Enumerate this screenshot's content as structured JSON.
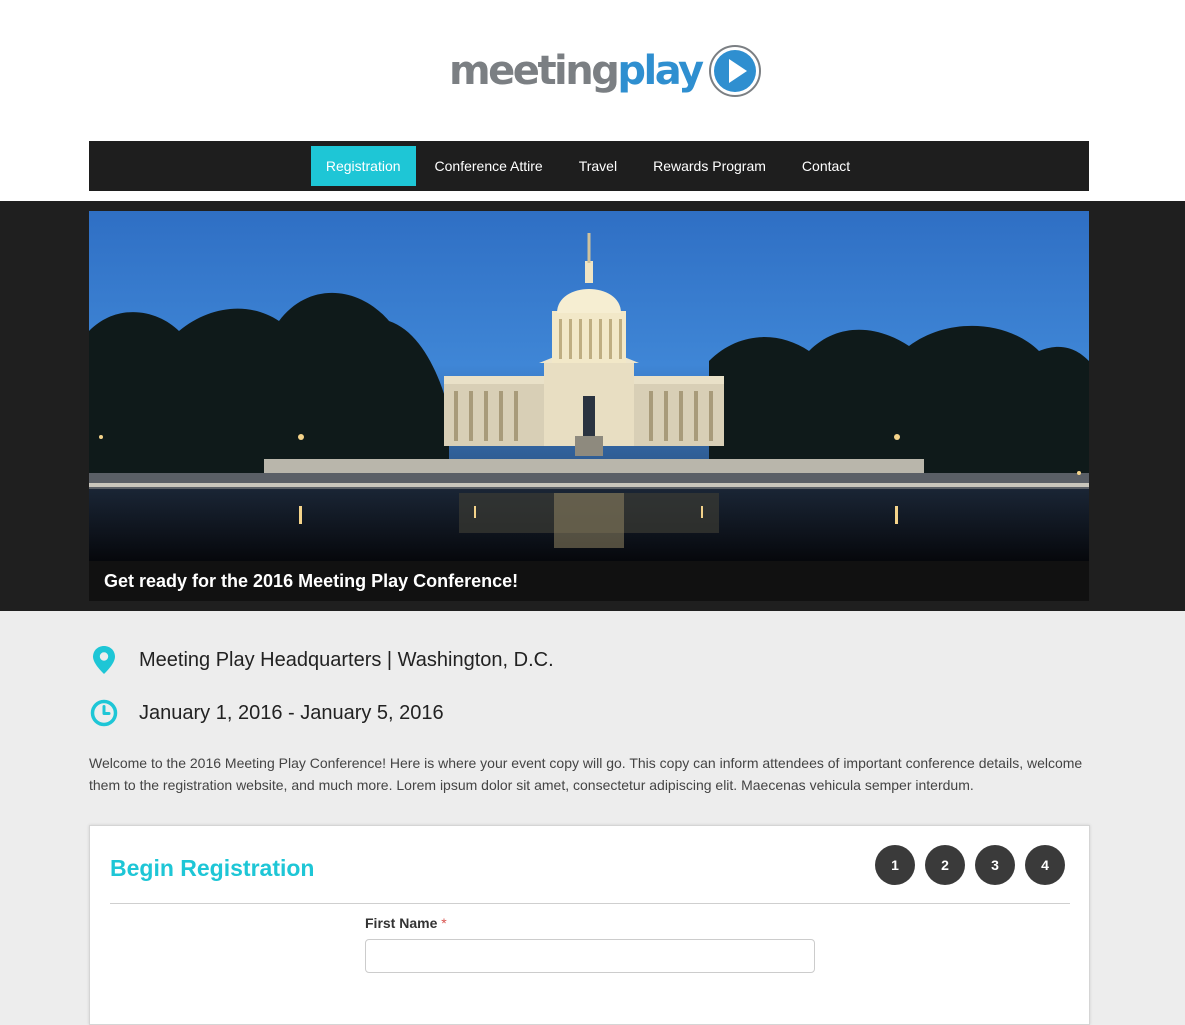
{
  "brand": {
    "logo_part1": "meeting",
    "logo_part2": "play"
  },
  "nav": {
    "items": [
      {
        "label": "Registration",
        "active": true
      },
      {
        "label": "Conference Attire",
        "active": false
      },
      {
        "label": "Travel",
        "active": false
      },
      {
        "label": "Rewards Program",
        "active": false
      },
      {
        "label": "Contact",
        "active": false
      }
    ]
  },
  "hero": {
    "caption": "Get ready for the 2016 Meeting Play Conference!"
  },
  "event": {
    "location": "Meeting Play Headquarters | Washington, D.C.",
    "dates": "January 1, 2016 - January 5, 2016",
    "location_icon": "map-pin-icon",
    "dates_icon": "clock-icon",
    "intro": "Welcome to the 2016 Meeting Play Conference! Here is where your event copy will go. This copy can inform attendees of important conference details, welcome them to the registration website, and much more. Lorem ipsum dolor sit amet, consectetur adipiscing elit. Maecenas vehicula semper interdum."
  },
  "registration": {
    "title": "Begin Registration",
    "steps": [
      "1",
      "2",
      "3",
      "4"
    ],
    "first_name_label": "First Name",
    "required_mark": "*",
    "first_name_value": ""
  },
  "colors": {
    "accent": "#1ec6d6",
    "nav_bg": "#1e1e1e",
    "logo_blue": "#2f8fd0",
    "logo_grey": "#7b7f83"
  }
}
